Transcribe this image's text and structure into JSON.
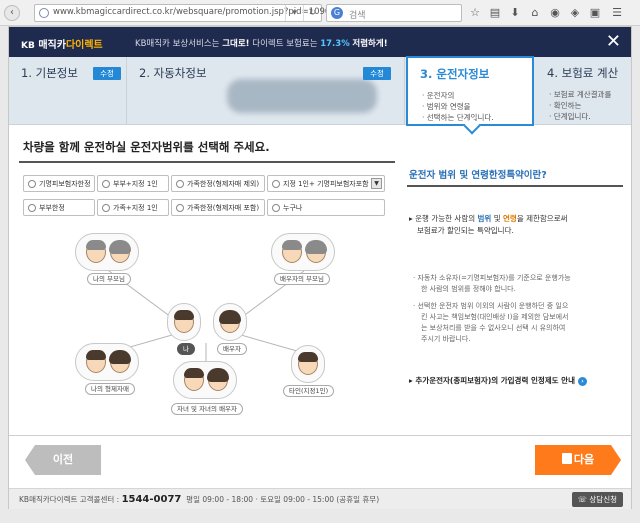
{
  "browser": {
    "url": "www.kbmagiccardirect.co.kr/websquare/promotion.jsp?pid=109004",
    "search_placeholder": "검색"
  },
  "header": {
    "brand_kb": "KB",
    "brand_magic": "매직카",
    "brand_direct": "다이렉트",
    "message_prefix": "KB매직카 보상서비스는",
    "message_bold": "그대로!",
    "message_mid": "다이렉트 보험료는",
    "message_pct": "17.3%",
    "message_suffix": "저렴하게!"
  },
  "steps": [
    {
      "title": "1. 기본정보",
      "edit": "수정"
    },
    {
      "title": "2. 자동차정보",
      "edit": "수정"
    },
    {
      "title": "3. 운전자정보",
      "desc": [
        "· 운전자의",
        "· 범위와 연령을",
        "· 선택하는 단계입니다."
      ]
    },
    {
      "title": "4. 보험료 계산",
      "desc": [
        "· 보험료 계산결과를",
        "· 확인하는",
        "· 단계입니다."
      ]
    }
  ],
  "main": {
    "title": "차량을 함께 운전하실 운전자범위를 선택해 주세요.",
    "options": [
      "기명피보험자한정",
      "부부+지정 1인",
      "가족한정(형제자매 제외)",
      "지정 1인+ 기명피보험자포함",
      "부부한정",
      "가족+지정 1인",
      "가족한정(형제자매 포함)",
      "누구나"
    ]
  },
  "diagram": {
    "parents": "나의 부모님",
    "spouse_parents": "배우자의 부모님",
    "me": "나",
    "spouse": "배우자",
    "siblings": "나의 형제자매",
    "children": "자녀 및 자녀의 배우자",
    "other": "타인(지정1인)"
  },
  "right_panel": {
    "title": "운전자 범위 및 연령한정특약이란?",
    "lead_1": "운행 가능한 사람의",
    "lead_range": "범위",
    "lead_and": "및",
    "lead_age": "연령",
    "lead_2": "을 제한함으로써",
    "lead_3": "보험료가 할인되는 특약입니다.",
    "note1_a": "자동차 소유자(=기명피보험자)를 기준으로 운행가능",
    "note1_b": "한 사람의 범위를 정해야 합니다.",
    "note2_a": "선택한 운전자 범위 이외의 사람이 운행하던 중 일으",
    "note2_b": "킨 사고는 책임보험(대인배상 I)을 제외한 담보에서",
    "note2_c": "는 보상처리를 받을 수 없사오니 선택 시 유의하여",
    "note2_d": "주시기 바랍니다.",
    "link": "추가운전자(종피보험자)의 가입경력 인정제도 안내"
  },
  "buttons": {
    "prev": "이전",
    "next": "다음"
  },
  "footer": {
    "center": "KB매직카다이렉트 고객콜센터 :",
    "phone": "1544-0077",
    "hours": "평일 09:00 - 18:00 · 토요일 09:00 - 15:00 (공휴일 휴무)",
    "consult": "상담신청"
  }
}
